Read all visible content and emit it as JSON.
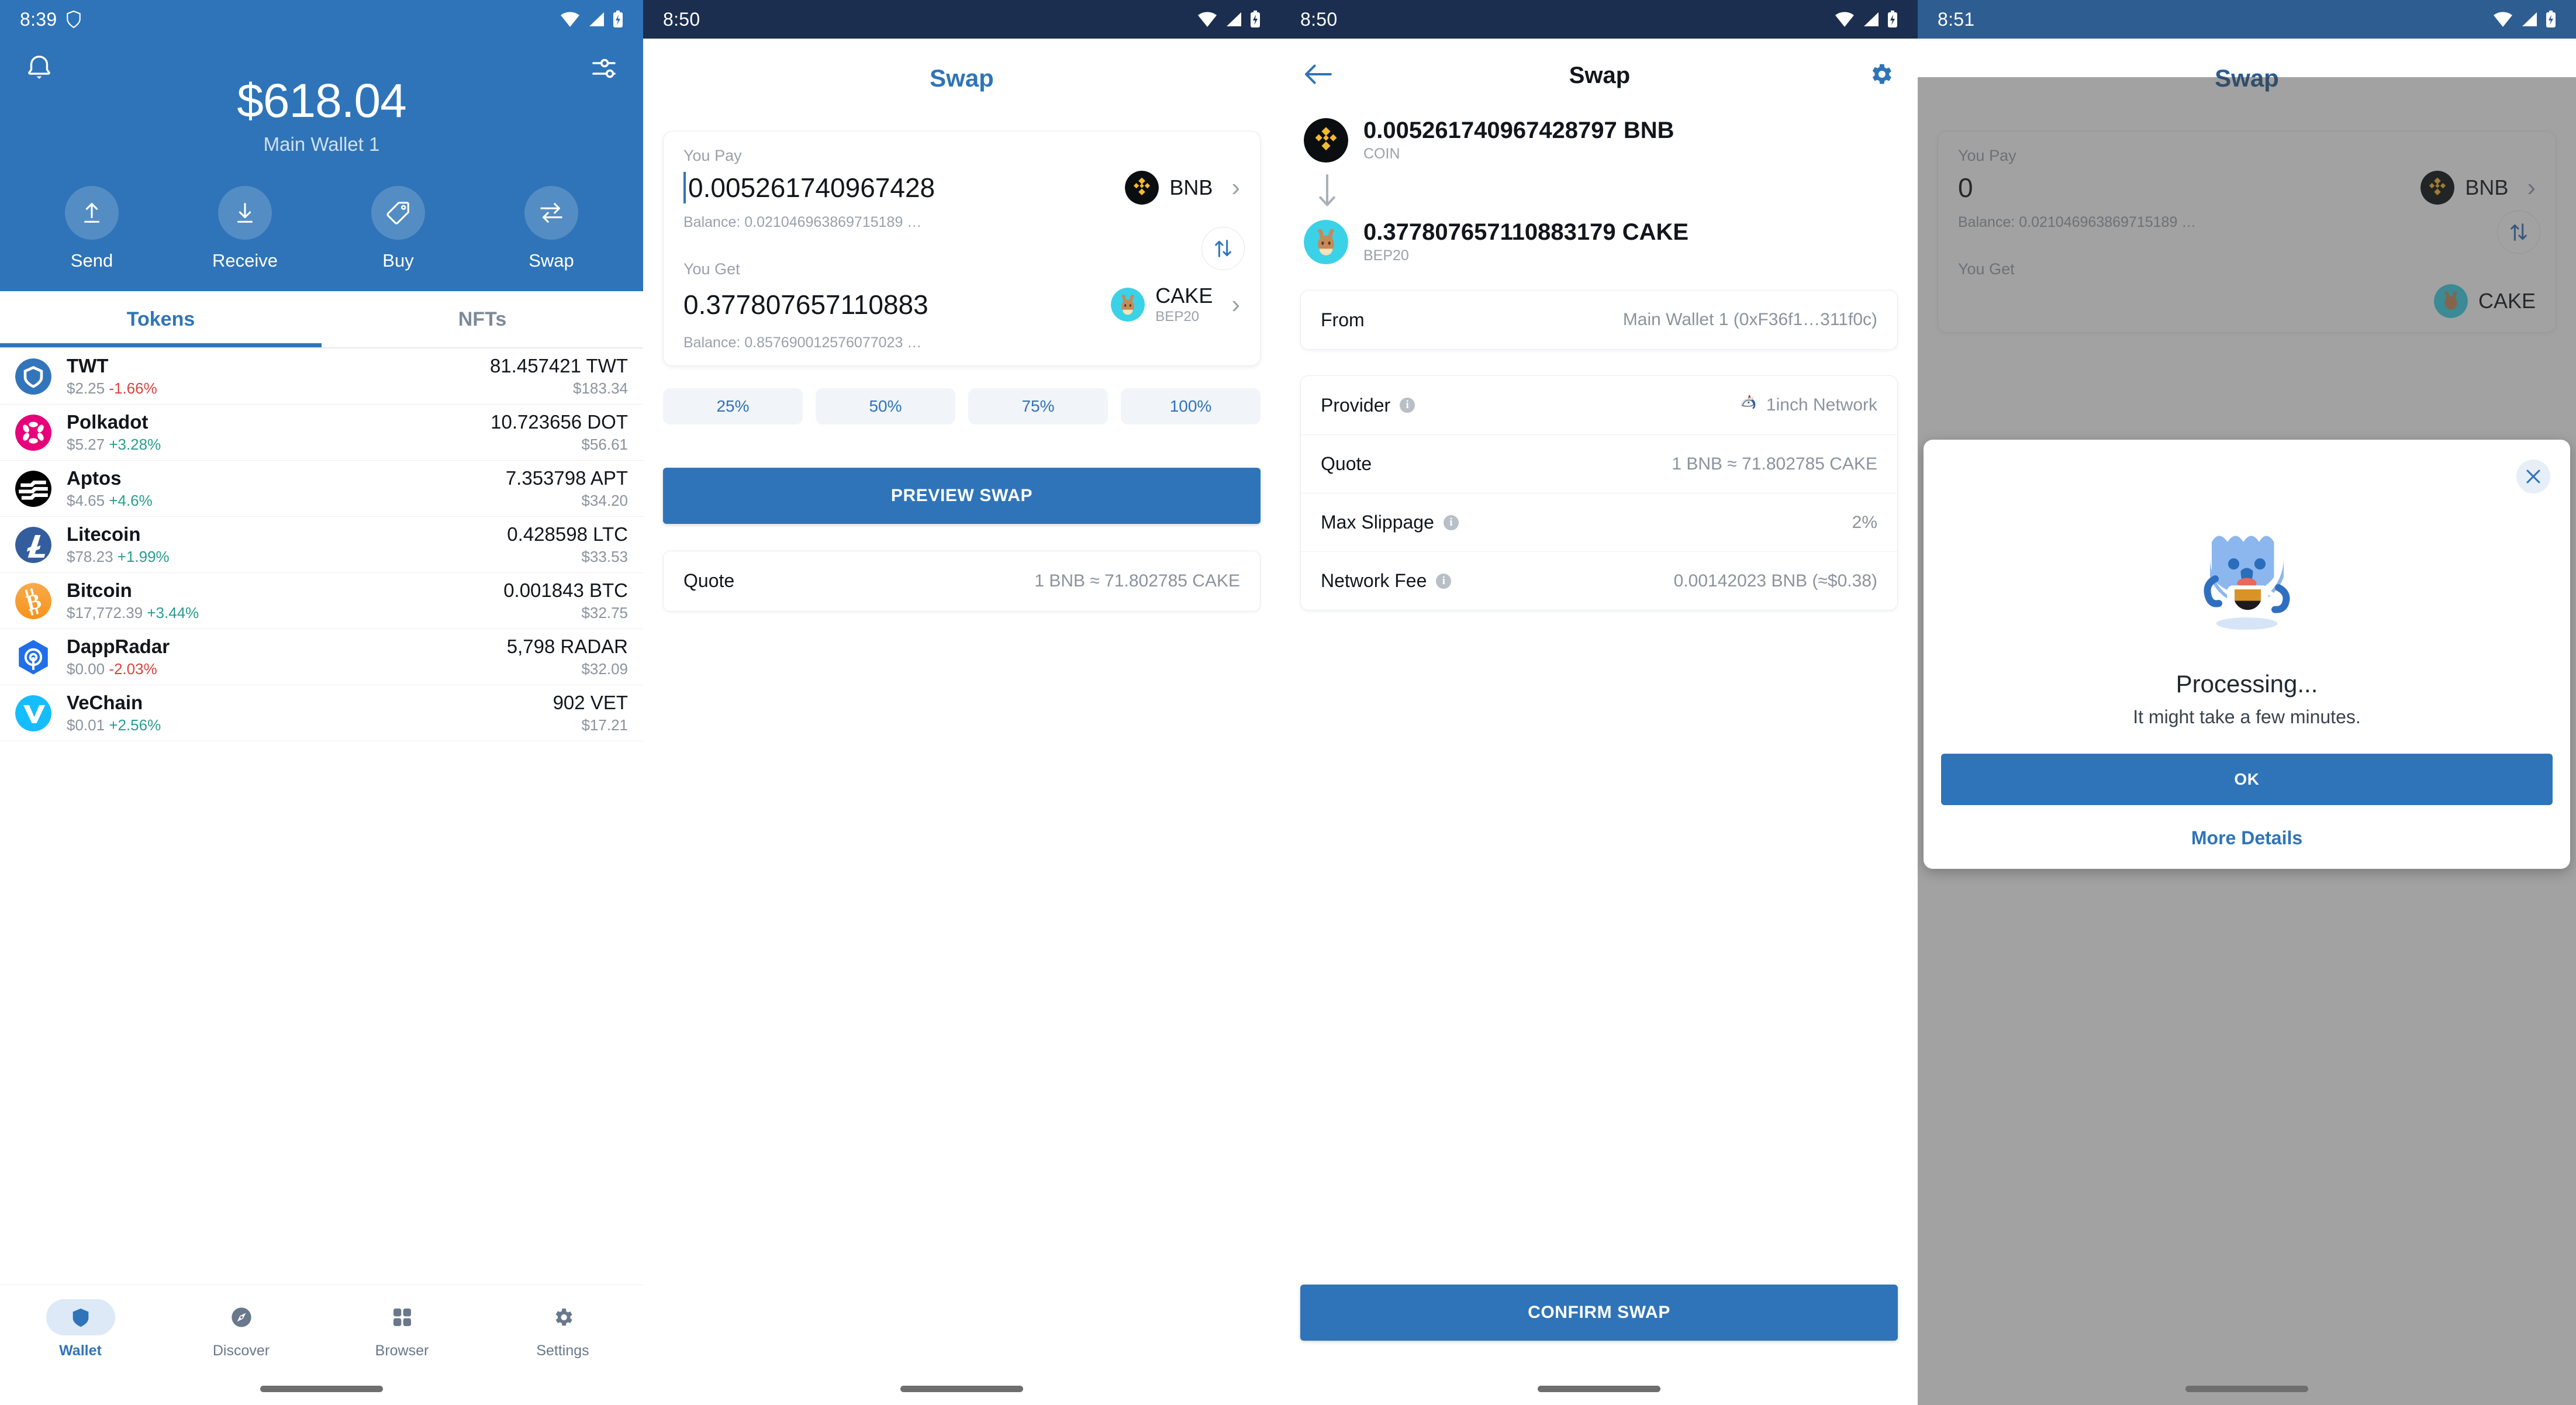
{
  "panels": {
    "wallet_home": {
      "status": {
        "time": "8:39",
        "shield_icon": "shield-icon",
        "wifi_icon": "wifi-icon",
        "signal_icon": "signal-icon",
        "battery_icon": "battery-charging-icon"
      },
      "header": {
        "bell_icon": "notification-bell-icon",
        "tune_icon": "tune-settings-icon",
        "balance": "$618.04",
        "wallet_name": "Main Wallet 1"
      },
      "actions": [
        {
          "label": "Send",
          "icon": "arrow-up-send-icon"
        },
        {
          "label": "Receive",
          "icon": "arrow-down-receive-icon"
        },
        {
          "label": "Buy",
          "icon": "price-tag-buy-icon"
        },
        {
          "label": "Swap",
          "icon": "swap-arrows-icon"
        }
      ],
      "tabs": [
        {
          "label": "Tokens",
          "active": true
        },
        {
          "label": "NFTs",
          "active": false
        }
      ],
      "tokens": [
        {
          "name": "TWT",
          "price": "$2.25",
          "change": "-1.66%",
          "dir": "down",
          "qty": "81.457421 TWT",
          "fiat": "$183.34",
          "color": "#3375bb",
          "glyph": "shield"
        },
        {
          "name": "Polkadot",
          "price": "$5.27",
          "change": "+3.28%",
          "dir": "up",
          "qty": "10.723656 DOT",
          "fiat": "$56.61",
          "color": "#e6007a",
          "glyph": "polkadot"
        },
        {
          "name": "Aptos",
          "price": "$4.65",
          "change": "+4.6%",
          "dir": "up",
          "qty": "7.353798 APT",
          "fiat": "$34.20",
          "color": "#000000",
          "glyph": "aptos"
        },
        {
          "name": "Litecoin",
          "price": "$78.23",
          "change": "+1.99%",
          "dir": "up",
          "qty": "0.428598 LTC",
          "fiat": "$33.53",
          "color": "#345d9d",
          "glyph": "litecoin"
        },
        {
          "name": "Bitcoin",
          "price": "$17,772.39",
          "change": "+3.44%",
          "dir": "up",
          "qty": "0.001843 BTC",
          "fiat": "$32.75",
          "color": "#f7931a",
          "glyph": "bitcoin"
        },
        {
          "name": "DappRadar",
          "price": "$0.00",
          "change": "-2.03%",
          "dir": "down",
          "qty": "5,798 RADAR",
          "fiat": "$32.09",
          "color": "#1f6feb",
          "glyph": "dappradar"
        },
        {
          "name": "VeChain",
          "price": "$0.01",
          "change": "+2.56%",
          "dir": "up",
          "qty": "902 VET",
          "fiat": "$17.21",
          "color": "#15bdff",
          "glyph": "vechain"
        }
      ],
      "bottom_nav": [
        {
          "label": "Wallet",
          "icon": "shield-wallet-icon",
          "active": true
        },
        {
          "label": "Discover",
          "icon": "compass-discover-icon",
          "active": false
        },
        {
          "label": "Browser",
          "icon": "grid-browser-icon",
          "active": false
        },
        {
          "label": "Settings",
          "icon": "gear-settings-icon",
          "active": false
        }
      ]
    },
    "swap_form": {
      "status": {
        "time": "8:50",
        "wifi_icon": "wifi-icon",
        "signal_icon": "signal-icon",
        "battery_icon": "battery-charging-icon"
      },
      "title": "Swap",
      "pay": {
        "label": "You Pay",
        "amount": "0.005261740967428",
        "token": "BNB",
        "network": "",
        "balance": "Balance: 0.021046963869715189 …",
        "chevron_icon": "chevron-right-icon",
        "token_icon": "bnb-token-icon"
      },
      "get": {
        "label": "You Get",
        "amount": "0.377807657110883",
        "token": "CAKE",
        "network": "BEP20",
        "balance": "Balance: 0.857690012576077023 …",
        "chevron_icon": "chevron-right-icon",
        "token_icon": "cake-token-icon"
      },
      "switch_icon": "swap-vertical-icon",
      "percents": [
        "25%",
        "50%",
        "75%",
        "100%"
      ],
      "preview_button": "PREVIEW SWAP",
      "quote": {
        "label": "Quote",
        "value": "1 BNB ≈ 71.802785 CAKE"
      }
    },
    "swap_confirm": {
      "status": {
        "time": "8:50",
        "wifi_icon": "wifi-icon",
        "signal_icon": "signal-icon",
        "battery_icon": "battery-charging-icon"
      },
      "back_icon": "back-arrow-icon",
      "title": "Swap",
      "settings_icon": "gear-settings-icon",
      "from_asset": {
        "amount": "0.005261740967428797 BNB",
        "network": "COIN",
        "token_icon": "bnb-token-icon"
      },
      "direction_icon": "arrow-down-icon",
      "to_asset": {
        "amount": "0.377807657110883179 CAKE",
        "network": "BEP20",
        "token_icon": "cake-token-icon"
      },
      "from_row": {
        "label": "From",
        "value": "Main Wallet 1  (0xF36f1…311f0c)"
      },
      "details": [
        {
          "label": "Provider",
          "info": true,
          "value": "1inch Network",
          "icon": "1inch-unicorn-icon"
        },
        {
          "label": "Quote",
          "info": false,
          "value": "1 BNB ≈ 71.802785 CAKE",
          "icon": ""
        },
        {
          "label": "Max Slippage",
          "info": true,
          "value": "2%",
          "icon": ""
        },
        {
          "label": "Network Fee",
          "info": true,
          "value": "0.00142023 BNB (≈$0.38)",
          "icon": ""
        }
      ],
      "confirm_button": "CONFIRM SWAP"
    },
    "processing": {
      "status": {
        "time": "8:51",
        "wifi_icon": "wifi-icon",
        "signal_icon": "signal-icon",
        "battery_icon": "battery-charging-icon"
      },
      "title": "Swap",
      "pay": {
        "label": "You Pay",
        "amount": "0",
        "token": "BNB",
        "balance": "Balance: 0.021046963869715189 …",
        "chevron_icon": "chevron-right-icon",
        "token_icon": "bnb-token-icon"
      },
      "get": {
        "label": "You Get",
        "token": "CAKE",
        "token_icon": "cake-token-icon"
      },
      "switch_icon": "swap-vertical-icon",
      "dialog": {
        "close_icon": "close-icon",
        "mascot_icon": "coffee-mascot-icon",
        "title": "Processing...",
        "subtitle": "It might take a few minutes.",
        "ok_button": "OK",
        "more_details_link": "More Details"
      }
    }
  },
  "colors": {
    "brand_blue": "#2f74b8",
    "navy_status": "#1b2e4f",
    "positive": "#2a9d8f",
    "negative": "#d9443f",
    "muted": "#8b939d"
  }
}
